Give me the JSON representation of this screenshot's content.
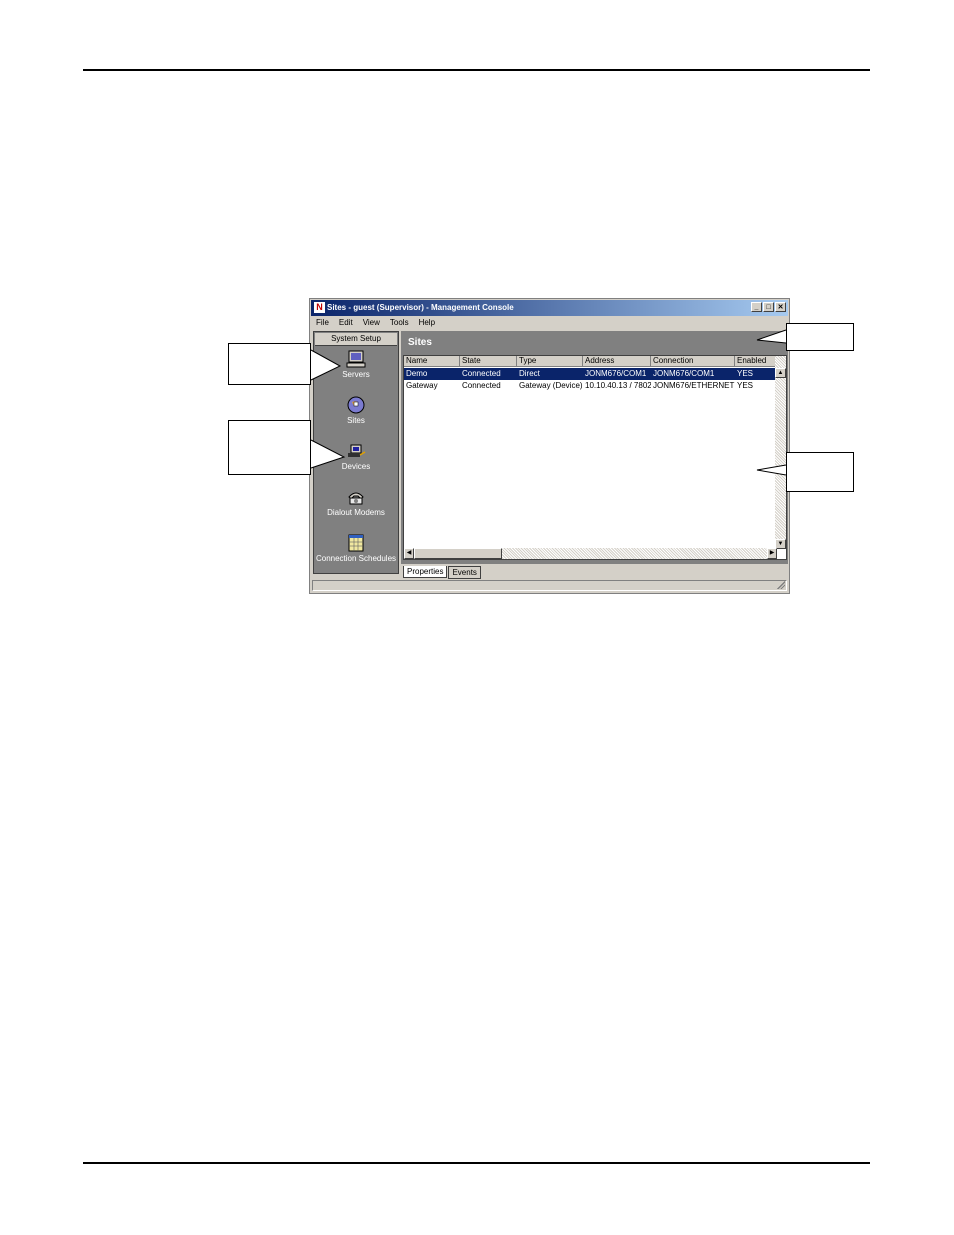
{
  "window": {
    "title": "Sites - guest (Supervisor) - Management Console",
    "app_icon_letter": "N",
    "buttons": {
      "minimize": "_",
      "maximize": "□",
      "close": "✕"
    }
  },
  "menu": [
    "File",
    "Edit",
    "View",
    "Tools",
    "Help"
  ],
  "sidebar": {
    "header": "System Setup",
    "items": [
      {
        "label": "Servers",
        "icon": "server-icon"
      },
      {
        "label": "Sites",
        "icon": "globe-icon"
      },
      {
        "label": "Devices",
        "icon": "device-icon"
      },
      {
        "label": "Dialout Modems",
        "icon": "telephone-icon"
      },
      {
        "label": "Connection Schedules",
        "icon": "calendar-icon"
      }
    ]
  },
  "main": {
    "title": "Sites",
    "columns": [
      "Name",
      "State",
      "Type",
      "Address",
      "Connection",
      "Enabled"
    ],
    "rows": [
      [
        "Demo",
        "Connected",
        "Direct",
        "JONM676/COM1",
        "JONM676/COM1",
        "YES"
      ],
      [
        "Gateway",
        "Connected",
        "Gateway (Device)",
        "10.10.40.13 / 7802",
        "JONM676/ETHERNET",
        "YES"
      ]
    ],
    "selected_row": 0
  },
  "tabs": [
    "Properties",
    "Events"
  ],
  "active_tab": 0,
  "colors": {
    "titlebar_start": "#0a246a",
    "titlebar_end": "#a6caf0",
    "panel_gray": "#808080",
    "face": "#d4d0c8",
    "selection": "#0a246a"
  }
}
